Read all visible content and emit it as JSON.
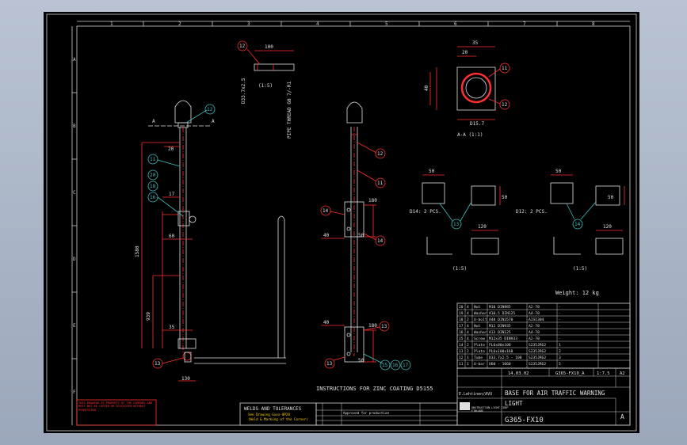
{
  "grid": {
    "cols": [
      "1",
      "2",
      "3",
      "4",
      "5",
      "6",
      "7",
      "8"
    ],
    "rows": [
      "A",
      "B",
      "C",
      "D",
      "E",
      "F"
    ]
  },
  "balloons": {
    "b11": "11",
    "b12": "12",
    "b13": "13",
    "b14": "14",
    "b15": "15",
    "b16": "16",
    "b17": "17",
    "b18": "18",
    "b20": "20"
  },
  "dims": {
    "d100": "100",
    "d35": "35",
    "d20": "20",
    "d17": "17",
    "d60": "60",
    "d1580": "1580",
    "d939": "939",
    "d130": "130",
    "d180": "180",
    "d50": "50",
    "d120": "120",
    "d40": "40",
    "d337": "D33.7",
    "d157": "D15.7",
    "d337x25": "D33.7x2.5"
  },
  "labels": {
    "scale_a": "(1:5)",
    "section_aa": "A-A (1:1)",
    "pipe_thread": "PIPE THREAD G0 7/-R1",
    "section_marker": "A",
    "pcs_left": "D14: 2 PCS.",
    "pcs_right": "D12: 2 PCS.",
    "scale_b": "(1:5)",
    "scale_c": "(1:5)",
    "weight": "Weight: 12 kg",
    "zinc": "INSTRUCTIONS FOR ZINC COATING D5155"
  },
  "bom": [
    [
      "20",
      "4",
      "Nut",
      "M10 DIN985",
      "A2-70",
      "-"
    ],
    [
      "19",
      "4",
      "Washer",
      "A10.5 DIN125",
      "A4-70",
      "-"
    ],
    [
      "18",
      "2",
      "U-bolt",
      "A48 DIN3570",
      "AISI304",
      "-"
    ],
    [
      "17",
      "4",
      "Nut",
      "M12 DIN935",
      "A2-70",
      "-"
    ],
    [
      "16",
      "4",
      "Washer",
      "A13 DIN125",
      "A4-70",
      "-"
    ],
    [
      "15",
      "4",
      "Screw",
      "M12x35 DIN933",
      "A2-70",
      "-"
    ],
    [
      "14",
      "2",
      "Plate",
      "FL6x80x100",
      "S235JRG2",
      "1"
    ],
    [
      "13",
      "2",
      "Plate",
      "PL6x100x168",
      "S235JRG2",
      "2"
    ],
    [
      "12",
      "1",
      "Tube",
      "D33.7x2.5 - 100",
      "S235JRG2",
      "3"
    ],
    [
      "11",
      "1",
      "U-bar",
      "U60 - 1660",
      "S235JRG2",
      "5"
    ]
  ],
  "title_block": {
    "date": "14.03.02",
    "file": "G365-FX10_A",
    "scale": "1:7.5",
    "size": "A2",
    "designer": "E.Lehtinen/AVU",
    "title_line1": "BASE FOR AIR TRAFFIC WARNING",
    "title_line2": "LIGHT",
    "doc_number": "G365-FX10",
    "revision": "A",
    "company": "OBSTRUCTION LIGHT CORP",
    "country": "FINLAND"
  },
  "notes": {
    "welds_title": "WELDS AND TOLERANCES",
    "welds_line1": "See Drawing      Gxxx-0P20",
    "welds_line2": "(Weld & Marking of the Corner)",
    "rev_text": "Approved for production",
    "red_note": "THIS DRAWING IS PROPERTY OF THE COMPANY AND MUST NOT BE COPIED OR DISCLOSED WITHOUT PERMISSION"
  }
}
